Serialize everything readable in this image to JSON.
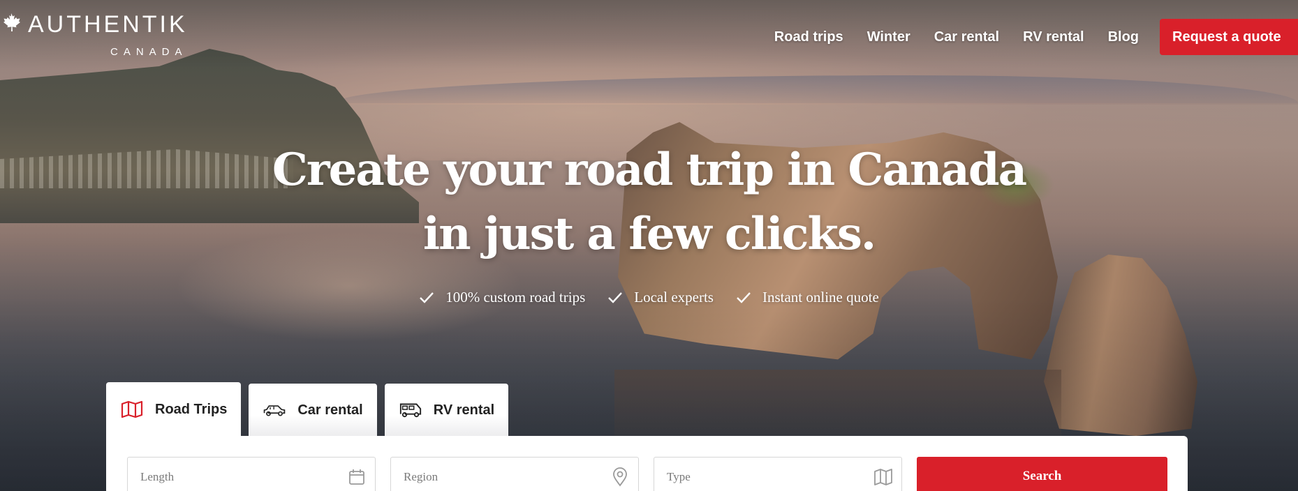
{
  "logo": {
    "name": "AUTHENTIK",
    "subtitle": "CANADA"
  },
  "nav": {
    "links": [
      "Road trips",
      "Winter",
      "Car rental",
      "RV rental",
      "Blog"
    ],
    "cta": "Request a quote"
  },
  "hero": {
    "headline_line1": "Create your road trip in Canada",
    "headline_line2": "in just a few clicks.",
    "features": [
      "100% custom road trips",
      "Local experts",
      "Instant online quote"
    ]
  },
  "tabs": [
    {
      "label": "Road Trips",
      "icon": "map-icon",
      "active": true
    },
    {
      "label": "Car rental",
      "icon": "car-icon",
      "active": false
    },
    {
      "label": "RV rental",
      "icon": "rv-icon",
      "active": false
    }
  ],
  "search": {
    "fields": [
      {
        "label": "Length",
        "icon": "calendar-icon"
      },
      {
        "label": "Region",
        "icon": "location-pin-icon"
      },
      {
        "label": "Type",
        "icon": "map-icon"
      }
    ],
    "button": "Search"
  },
  "colors": {
    "accent": "#d9202a",
    "text": "#222222"
  }
}
